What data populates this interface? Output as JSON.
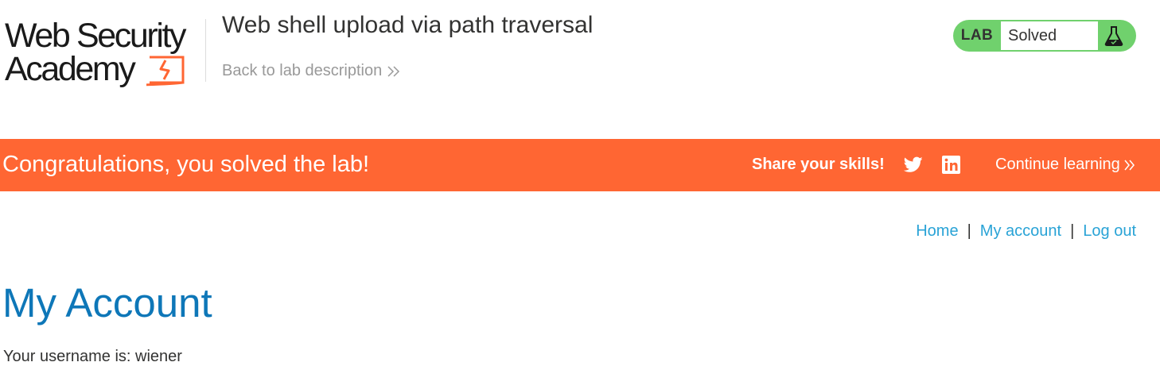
{
  "header": {
    "logo": {
      "line1": "Web Security",
      "line2": "Academy",
      "accent_color": "#ff6633"
    },
    "lab_title": "Web shell upload via path traversal",
    "back_link": "Back to lab description",
    "back_icon": "double-chevron-right-icon"
  },
  "lab_status": {
    "label": "LAB",
    "state": "Solved",
    "color": "#70d16d",
    "icon": "flask-icon"
  },
  "banner": {
    "message": "Congratulations, you solved the lab!",
    "share_label": "Share your skills!",
    "share_icons": [
      "twitter-icon",
      "linkedin-icon"
    ],
    "continue_label": "Continue learning",
    "background": "#ff6633"
  },
  "nav": {
    "items": [
      "Home",
      "My account",
      "Log out"
    ],
    "separator": "|"
  },
  "content": {
    "title": "My Account",
    "username_text": "Your username is: wiener"
  }
}
